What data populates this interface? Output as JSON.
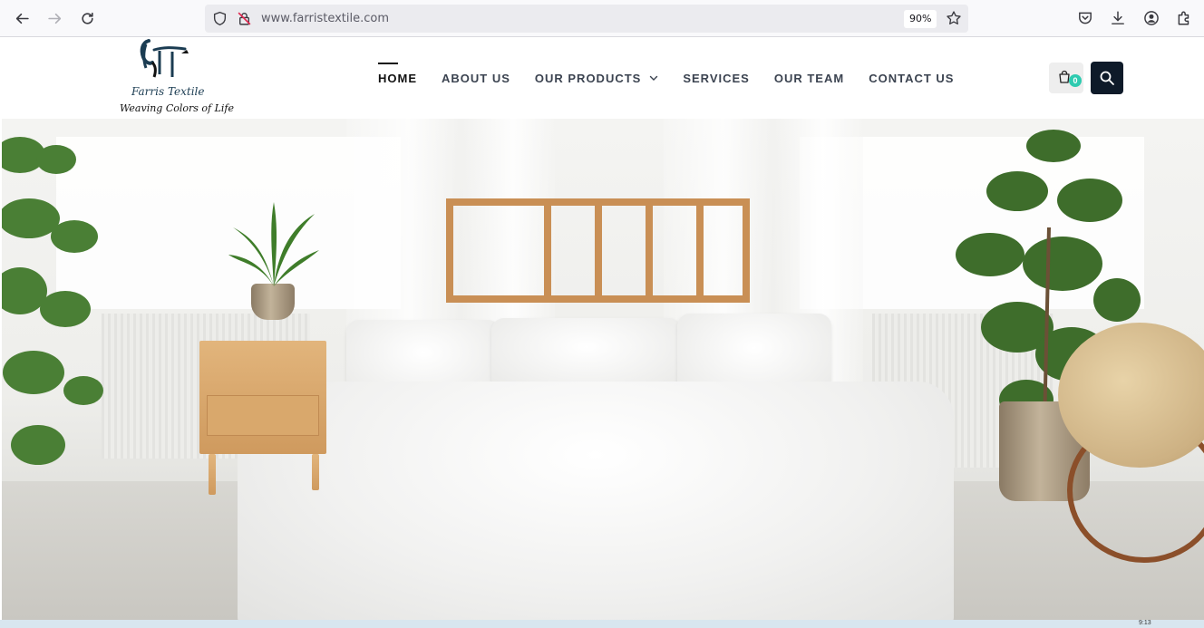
{
  "browser": {
    "url": "www.farristextile.com",
    "zoom": "90%",
    "icons": [
      "back-arrow-icon",
      "forward-arrow-icon",
      "reload-icon",
      "shield-icon",
      "lock-slash-icon",
      "bookmark-star-icon",
      "pocket-icon",
      "download-icon",
      "account-icon",
      "extensions-icon"
    ]
  },
  "site": {
    "logo": {
      "name": "Farris Textile",
      "tagline": "Weaving Colors of Life"
    },
    "nav": [
      {
        "label": "HOME",
        "active": true
      },
      {
        "label": "ABOUT US"
      },
      {
        "label": "OUR PRODUCTS",
        "has_dropdown": true
      },
      {
        "label": "SERVICES"
      },
      {
        "label": "OUR TEAM"
      },
      {
        "label": "CONTACT US"
      }
    ],
    "cart": {
      "count": "0"
    },
    "colors": {
      "accent": "#2ecbb0",
      "dark": "#0e1a29",
      "wood": "#c98f55"
    }
  },
  "hero": {
    "image_icon": "bedroom-hero-image"
  },
  "taskbar": {
    "clock": "9:13"
  }
}
